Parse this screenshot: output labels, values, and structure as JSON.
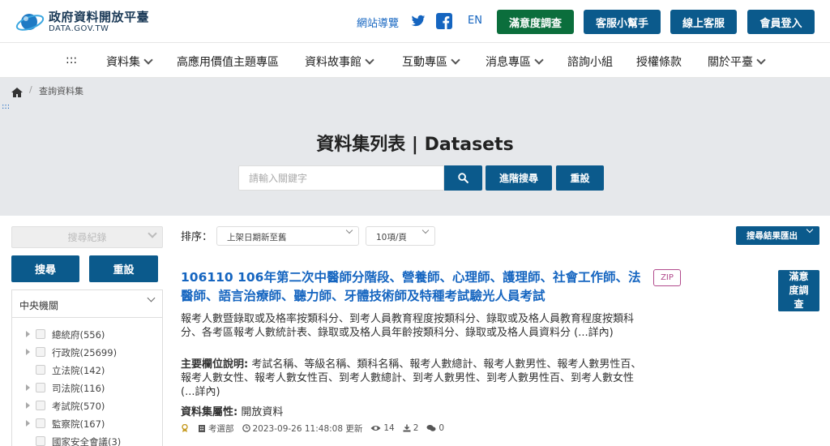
{
  "header": {
    "logo_title": "政府資料開放平臺",
    "logo_sub": "DATA.GOV.TW",
    "sitemap": "網站導覽",
    "lang": "EN",
    "buttons": [
      "滿意度調查",
      "客服小幫手",
      "線上客服",
      "會員登入"
    ]
  },
  "nav": {
    "anchor": ":::",
    "items": [
      "資料集",
      "高應用價值主題專區",
      "資料故事館",
      "互動專區",
      "消息專區",
      "諮詢小組",
      "授權條款",
      "關於平臺"
    ]
  },
  "hero": {
    "breadcrumb": "查詢資料集",
    "anchor": ":::",
    "title": "資料集列表 | Datasets",
    "search_placeholder": "請輸入關鍵字",
    "advanced_label": "進階搜尋",
    "reset_label": "重設"
  },
  "sidebar": {
    "history_placeholder": "搜尋紀錄",
    "search_label": "搜尋",
    "reset_label": "重設",
    "facet_title": "中央機關",
    "facets": [
      "總統府(556)",
      "行政院(25699)",
      "立法院(142)",
      "司法院(116)",
      "考試院(570)",
      "監察院(167)",
      "國家安全會議(3)"
    ]
  },
  "main": {
    "sort_label": "排序：",
    "sort_value": "上架日期新至舊",
    "page_size": "10項/頁",
    "export_label": "搜尋結果匯出",
    "dataset": {
      "title": "106110 106年第二次中醫師分階段、營養師、心理師、護理師、社會工作師、法醫師、語言治療師、聽力師、牙體技術師及特種考試驗光人員考試",
      "format": "ZIP",
      "satisfaction": "滿意度調查",
      "description": "報考人數暨錄取或及格率按類科分、到考人員教育程度按類科分、錄取或及格人員教育程度按類科分、各考區報考人數統計表、錄取或及格人員年齡按類科分、錄取或及格人員資料分 (...詳內)",
      "fields_label": "主要欄位說明:",
      "fields": "考試名稱、等級名稱、類科名稱、報考人數總計、報考人數男性、報考人數男性百、報考人數女性、報考人數女性百、到考人數總計、到考人數男性、到考人數男性百、到考人數女性 (...詳內)",
      "attr_label": "資料集屬性:",
      "attr_value": "開放資料",
      "agency": "考選部",
      "updated": "2023-09-26 11:48:08 更新",
      "views": "14",
      "downloads": "2",
      "comments": "0"
    }
  },
  "colors": {
    "primary": "#0b5a8c",
    "green": "#0b6e3c",
    "link": "#1565c0",
    "hero_bg": "#e6e8eb",
    "zip": "#b14a8c"
  }
}
